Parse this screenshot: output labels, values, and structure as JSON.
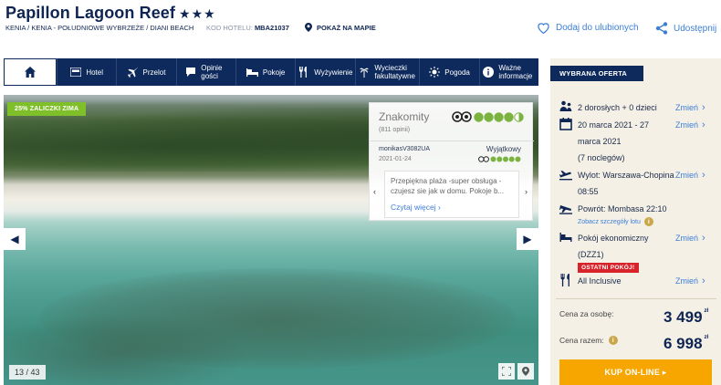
{
  "header": {
    "title": "Papillon Lagoon Reef",
    "stars": "★★★",
    "breadcrumb": "KENIA / KENIA - POŁUDNIOWE WYBRZEŻE / DIANI BEACH",
    "hotel_code_label": "KOD HOTELU:",
    "hotel_code": "MBA21037",
    "map_link": "POKAŻ NA MAPIE",
    "favorite": "Dodaj do ulubionych",
    "share": "Udostępnij"
  },
  "nav": {
    "items": [
      {
        "label": "Hotel",
        "icon": "bed-icon"
      },
      {
        "label": "Przelot",
        "icon": "plane-icon"
      },
      {
        "label": "Opinie gości",
        "icon": "speech-bubble-icon"
      },
      {
        "label": "Pokoje",
        "icon": "bed-icon"
      },
      {
        "label": "Wyżywienie",
        "icon": "cutlery-icon"
      },
      {
        "label": "Wycieczki fakultatywne",
        "icon": "palm-tree-icon"
      },
      {
        "label": "Pogoda",
        "icon": "sun-icon"
      },
      {
        "label": "Ważne informacje",
        "icon": "info-icon"
      }
    ]
  },
  "gallery": {
    "promo": "25% ZALICZKI ZIMA",
    "counter": "13 / 43"
  },
  "review": {
    "rating_text": "Znakomity",
    "review_count": "(811 opinii)",
    "author": "monikasV3082UA",
    "verdict": "Wyjątkowy",
    "date": "2021-01-24",
    "quote": "Przepiękna plaża -super obsługa -czujesz sie jak w domu. Pokoje b...",
    "more": "Czytaj więcej"
  },
  "offer": {
    "header": "WYBRANA OFERTA",
    "guests": "2 dorosłych + 0 dzieci",
    "dates_line1": "20 marca 2021 - 27",
    "dates_line2": "marca 2021",
    "nights": "(7 noclegów)",
    "departure_line1": "Wylot: Warszawa-Chopina",
    "departure_line2": "08:55",
    "return": "Powrót: Mombasa 22:10",
    "flight_details": "Zobacz szczegóły lotu",
    "room_line1": "Pokój ekonomiczny",
    "room_line2": "(DZZ1)",
    "last_room_badge": "OSTATNI POKÓJ!",
    "board": "All Inclusive",
    "change_label": "Zmień",
    "price_per_person_label": "Cena za osobę:",
    "price_per_person": "3 499",
    "price_total_label": "Cena razem:",
    "price_total": "6 998",
    "currency": "zł",
    "buy_label": "KUP ON-LINE ▸"
  }
}
